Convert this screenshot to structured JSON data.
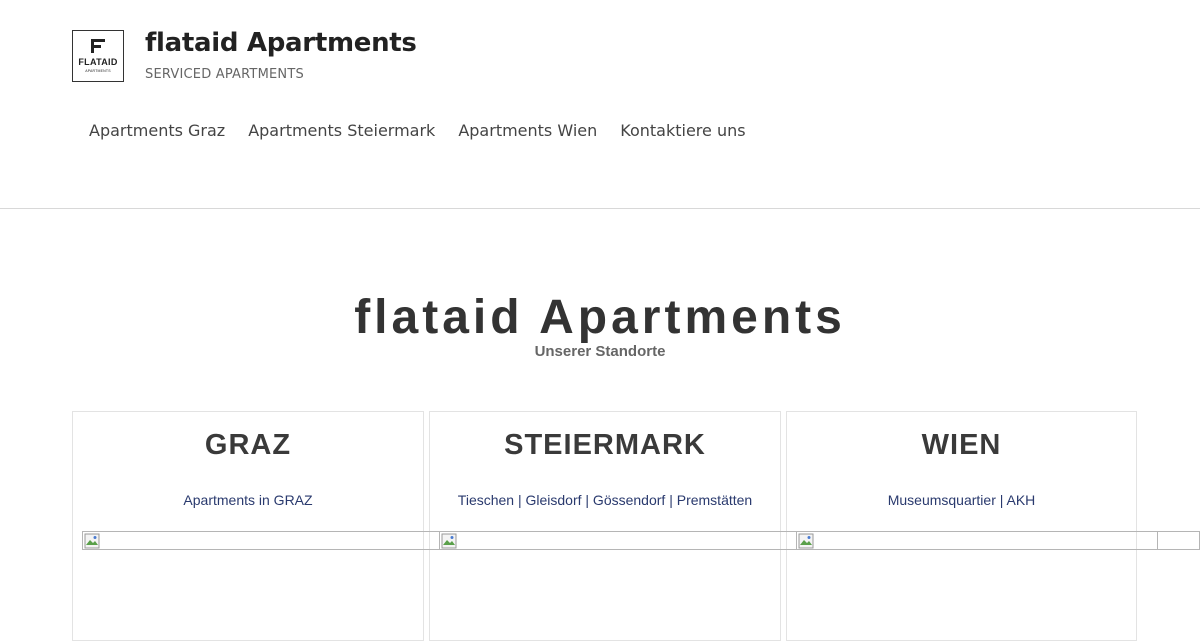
{
  "site": {
    "logo_word": "FLATAID",
    "logo_sub": "APARTMENTS",
    "title": "flataid Apartments",
    "tagline": "SERVICED APARTMENTS"
  },
  "nav": {
    "items": [
      {
        "label": "Apartments Graz"
      },
      {
        "label": "Apartments Steiermark"
      },
      {
        "label": "Apartments Wien"
      },
      {
        "label": "Kontaktiere uns"
      }
    ]
  },
  "hero": {
    "title": "flataid Apartments",
    "subtitle": "Unserer Standorte"
  },
  "locations": [
    {
      "title": "GRAZ",
      "link": "Apartments in GRAZ",
      "image_icon": "broken-image-icon"
    },
    {
      "title": "STEIERMARK",
      "link": "Tieschen | Gleisdorf | Gössendorf | Premstätten",
      "image_icon": "broken-image-icon"
    },
    {
      "title": "WIEN",
      "link": "Museumsquartier | AKH",
      "image_icon": "broken-image-icon"
    }
  ],
  "colors": {
    "link": "#2a3a6e",
    "heading": "#333333",
    "divider": "#d8d8d8"
  }
}
